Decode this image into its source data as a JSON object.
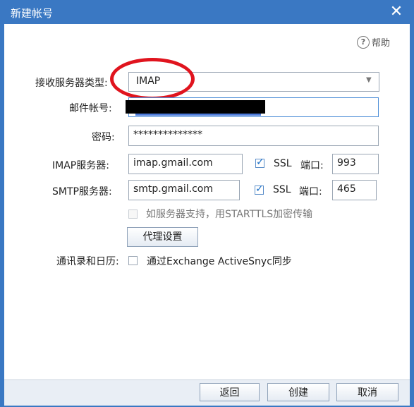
{
  "window": {
    "title": "新建帐号"
  },
  "help": {
    "label": "帮助",
    "icon": "help-circle-icon"
  },
  "form": {
    "server_type": {
      "label": "接收服务器类型:",
      "value": "IMAP"
    },
    "email": {
      "label": "邮件帐号:"
    },
    "password": {
      "label": "密码:",
      "value": "**************"
    },
    "imap": {
      "label": "IMAP服务器:",
      "value": "imap.gmail.com",
      "ssl_label": "SSL",
      "port_label": "端口:",
      "port_value": "993"
    },
    "smtp": {
      "label": "SMTP服务器:",
      "value": "smtp.gmail.com",
      "ssl_label": "SSL",
      "port_label": "端口:",
      "port_value": "465"
    },
    "starttls": {
      "label": "如服务器支持，用STARTTLS加密传输"
    },
    "proxy_button": "代理设置",
    "sync": {
      "label": "通讯录和日历:",
      "option_label": "通过Exchange ActiveSnyc同步"
    }
  },
  "footer": {
    "back": "返回",
    "create": "创建",
    "cancel": "取消"
  }
}
